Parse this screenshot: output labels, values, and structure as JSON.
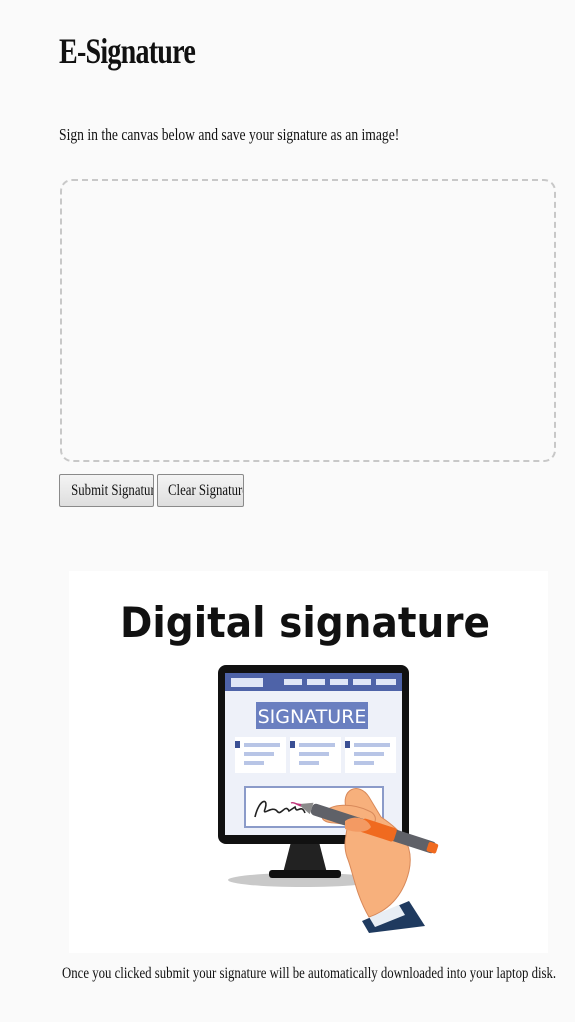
{
  "page": {
    "title": "E-Signature",
    "instruction": "Sign in the canvas below and save your signature as an image!"
  },
  "signature_pad": {
    "submit_label": "Submit Signature",
    "clear_label": "Clear Signature"
  },
  "illustration": {
    "heading": "Digital signature",
    "screen_label": "SIGNATURE"
  },
  "footnote": "Once you clicked submit your signature will be automatically downloaded into your laptop disk.",
  "colors": {
    "page_background": "#fafafa",
    "canvas_border": "#c8c8c8",
    "screen_blue": "#5b72b5",
    "hand_skin": "#f7b07c",
    "pen_orange": "#f06a1f"
  }
}
